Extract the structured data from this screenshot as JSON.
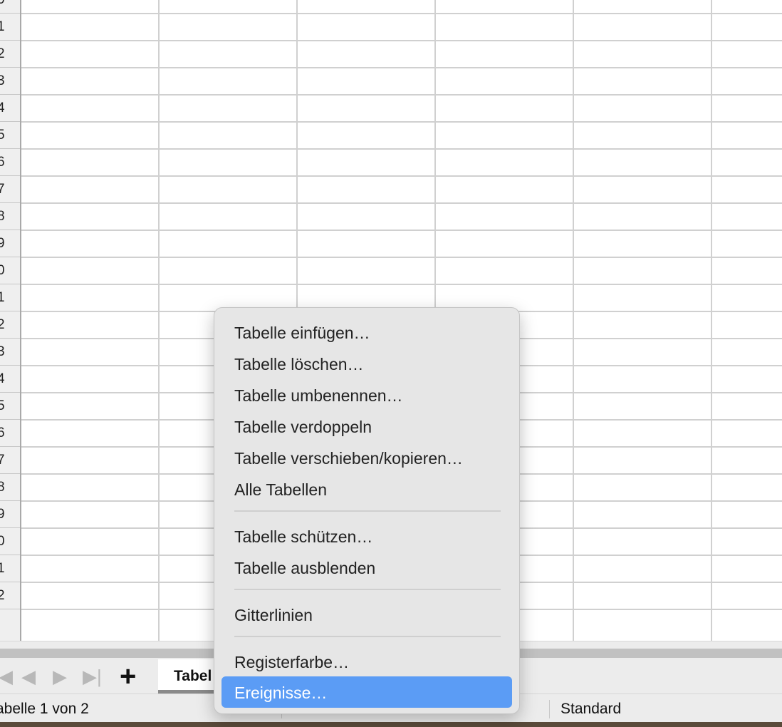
{
  "grid": {
    "row_numbers": [
      "0",
      "1",
      "2",
      "3",
      "4",
      "5",
      "6",
      "7",
      "8",
      "9",
      "0",
      "1",
      "2",
      "3",
      "4",
      "5",
      "6",
      "7",
      "8",
      "9",
      "0",
      "1",
      "2"
    ]
  },
  "tabbar": {
    "nav_first": "◀",
    "nav_prev": "◀",
    "nav_next": "▶",
    "nav_last": "▶|",
    "add_label": "+",
    "active_tab_label": "Tabel"
  },
  "statusbar": {
    "sheet_info": "abelle 1 von 2",
    "page_style": "Standard"
  },
  "context_menu": {
    "items": [
      "Tabelle einfügen…",
      "Tabelle löschen…",
      "Tabelle umbenennen…",
      "Tabelle verdoppeln",
      "Tabelle verschieben/kopieren…",
      "Alle Tabellen",
      "Tabelle schützen…",
      "Tabelle ausblenden",
      "Gitterlinien",
      "Registerfarbe…",
      "Ereignisse…"
    ],
    "selected_item": "Ereignisse…",
    "highlight_color": "#5b9cf5"
  }
}
